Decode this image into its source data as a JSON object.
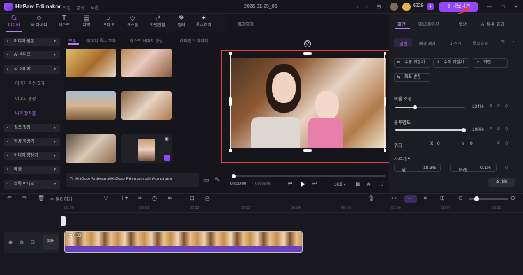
{
  "app": {
    "title": "HitPaw Edimakor",
    "menus": [
      "파일",
      "설정",
      "도움"
    ],
    "date": "2026-01-29_06",
    "coins": "6229",
    "export_label": "내보내기"
  },
  "toolbar": {
    "tools": [
      {
        "label": "미디어",
        "icon": "media-icon"
      },
      {
        "label": "AI 아바타",
        "icon": "avatar-icon"
      },
      {
        "label": "텍스트",
        "icon": "text-icon"
      },
      {
        "label": "자막",
        "icon": "subtitle-icon"
      },
      {
        "label": "오디오",
        "icon": "audio-icon"
      },
      {
        "label": "요소들",
        "icon": "elements-icon"
      },
      {
        "label": "화면전환",
        "icon": "transition-icon"
      },
      {
        "label": "필터",
        "icon": "filter-icon"
      },
      {
        "label": "특수효과",
        "icon": "effects-icon"
      }
    ]
  },
  "sidebar": {
    "items": [
      {
        "label": "미디어 원본"
      },
      {
        "label": "AI 비디오"
      },
      {
        "label": "AI 이미지"
      },
      {
        "label": "이미지 특수 효과"
      },
      {
        "label": "이미지 생성"
      },
      {
        "label": "나의 창작물"
      },
      {
        "label": "팔로 필링"
      },
      {
        "label": "영상 향상기"
      },
      {
        "label": "이미지 향상기"
      },
      {
        "label": "배경"
      },
      {
        "label": "스톡 비디오"
      }
    ]
  },
  "media": {
    "tabs": [
      "모두",
      "이미지 특수 효과",
      "텍스트 이미지 생성",
      "레퍼런스 이미지"
    ],
    "path": "D:/HitPaw Software/HitPaw Edimakor/AI Generator"
  },
  "player": {
    "title": "플레이어",
    "time_current": "00:00:00",
    "time_total": "00:03:00",
    "ratio": "16:9"
  },
  "right": {
    "tabs": [
      "화면",
      "애니메이션",
      "색상",
      "AI 특수 효과"
    ],
    "subtabs": [
      "일반",
      "배경 제거",
      "마스크",
      "특수효과",
      "AI"
    ],
    "buttons": [
      "수평 뒤집기",
      "수직 뒤집기",
      "회전",
      "좌표 반전"
    ],
    "scale_label": "비율 조정",
    "scale_value": "134%",
    "opacity_label": "불투명도",
    "opacity_value": "100%",
    "position_label": "위치",
    "x_label": "X",
    "x_value": "0",
    "y_label": "Y",
    "y_value": "0",
    "crop_label": "자르기",
    "top_label": "위",
    "top_value": "18.3%",
    "bottom_label": "아래",
    "bottom_value": "0.1%",
    "reset_label": "초기화"
  },
  "timeline": {
    "ticks": [
      "00:00",
      "00:01",
      "00:02",
      "00:03",
      "00:04",
      "00:05",
      "00:06",
      "00:07",
      "00:08"
    ],
    "track_label": "커버",
    "clip_duration": "0:03",
    "split_label": "분리하기"
  }
}
